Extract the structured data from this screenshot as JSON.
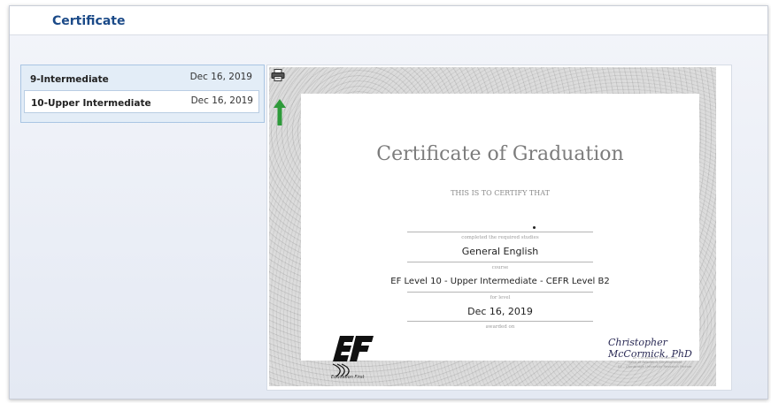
{
  "header": {
    "title": "Certificate"
  },
  "levels": [
    {
      "name": "9-Intermediate",
      "date": "Dec 16, 2019"
    },
    {
      "name": "10-Upper Intermediate",
      "date": "Dec 16, 2019"
    }
  ],
  "certificate": {
    "title": "Certificate of Graduation",
    "certify_text": "THIS IS TO CERTIFY THAT",
    "completed_caption": "completed the required studies",
    "course": "General English",
    "course_caption": "course",
    "level": "EF Level 10 - Upper Intermediate - CEFR Level B2",
    "level_caption": "for level",
    "date": "Dec 16, 2019",
    "date_caption": "awarded on",
    "logo_caption": "Education First",
    "signature": "Christopher McCormick, PhD",
    "signer_name": "Dr. Christopher McCormick",
    "signer_title": "Head of Academic Development",
    "signer_org": "EF – Cambridge University Research Partner"
  },
  "colors": {
    "title": "#1b4a88",
    "arrow": "#2e9a3a",
    "panel": "#e3edf7"
  },
  "icons": {
    "print": "printer-icon",
    "arrow": "arrow-up-icon"
  }
}
